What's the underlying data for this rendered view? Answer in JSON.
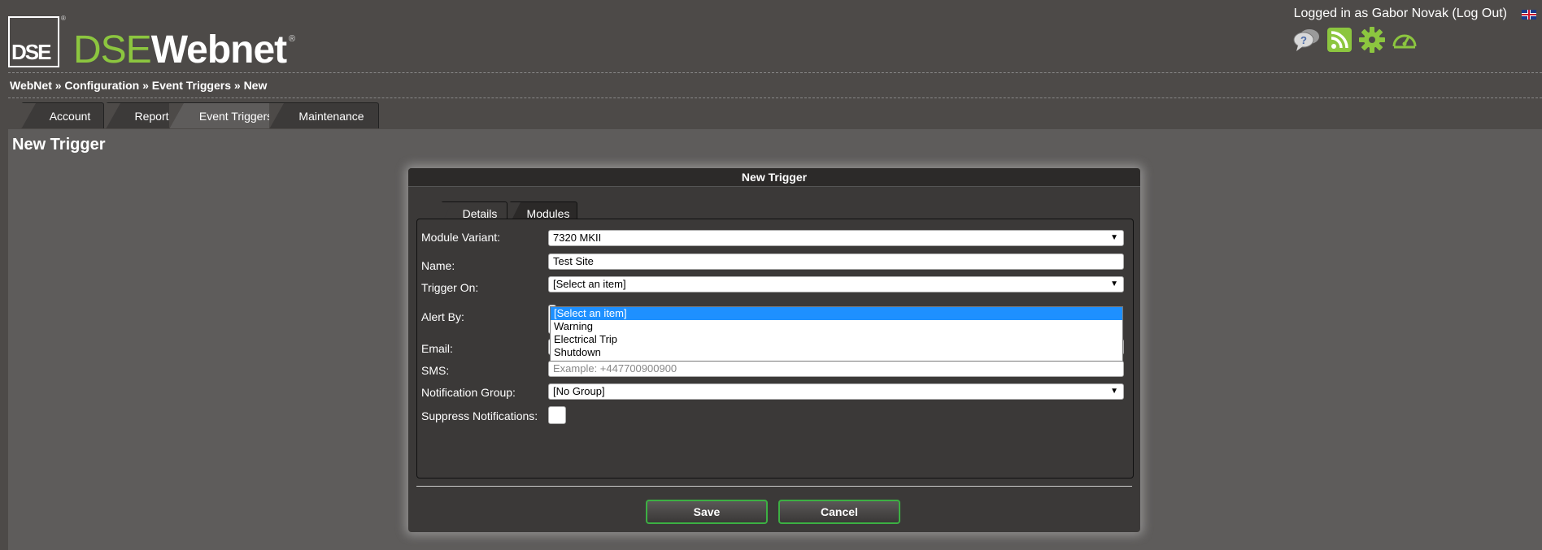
{
  "header": {
    "logo_text": "DSE",
    "brand_dse": "DSE",
    "brand_webnet": "Webnet",
    "reg_mark": "®",
    "user_prefix": "Logged in as Gabor Novak (",
    "logout_label": "Log Out",
    "user_suffix": ")",
    "icons": [
      "help-chat-icon",
      "rss-feed-icon",
      "settings-gear-icon",
      "dashboard-gauge-icon"
    ],
    "accent_color": "#8cc63f"
  },
  "breadcrumb": "WebNet » Configuration » Event Triggers » New",
  "tabs": [
    {
      "label": "Account"
    },
    {
      "label": "Reports"
    },
    {
      "label": "Event Triggers",
      "active": true
    },
    {
      "label": "Maintenance"
    }
  ],
  "page_title": "New Trigger",
  "panel": {
    "title": "New Trigger",
    "subtabs": [
      {
        "label": "Details",
        "active": true
      },
      {
        "label": "Modules"
      }
    ],
    "fields": {
      "module_variant": {
        "label": "Module Variant:",
        "value": "7320 MKII"
      },
      "name": {
        "label": "Name:",
        "value": "Test Site"
      },
      "trigger_on": {
        "label": "Trigger On:",
        "value": "[Select an item]",
        "options": [
          "[Select an item]",
          "Warning",
          "Electrical Trip",
          "Shutdown"
        ]
      },
      "alert_by": {
        "label": "Alert By:"
      },
      "email": {
        "label": "Email:",
        "value": ""
      },
      "sms": {
        "label": "SMS:",
        "placeholder": "Example: +447700900900"
      },
      "notification_group": {
        "label": "Notification Group:",
        "value": "[No Group]"
      },
      "suppress": {
        "label": "Suppress Notifications:",
        "checked": false
      }
    },
    "save_label": "Save",
    "cancel_label": "Cancel",
    "button_border_color": "#3cb043"
  }
}
